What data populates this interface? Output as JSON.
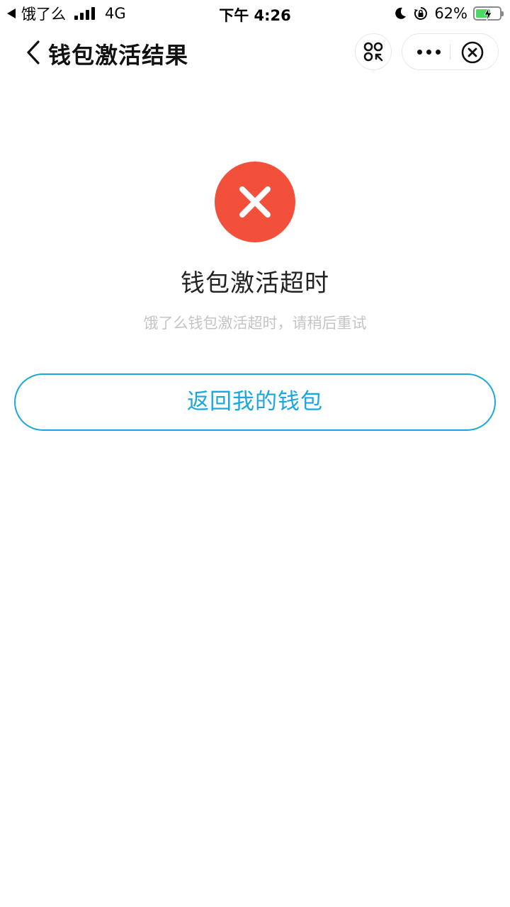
{
  "status_bar": {
    "carrier": "饿了么",
    "network": "4G",
    "time": "下午 4:26",
    "battery": "62%",
    "battery_level": 0.62,
    "icons": [
      "back-triangle-icon",
      "signal-icon",
      "moon-icon",
      "orientation-lock-icon",
      "battery-icon",
      "charging-bolt-icon"
    ]
  },
  "nav": {
    "title": "钱包激活结果",
    "icons": [
      "back-chevron-icon",
      "mini-program-switch-icon",
      "more-dots-icon",
      "close-circle-icon"
    ]
  },
  "result": {
    "title": "钱包激活超时",
    "description": "饿了么钱包激活超时，请稍后重试",
    "icon": "error-x-icon"
  },
  "actions": {
    "back_to_wallet_label": "返回我的钱包"
  },
  "colors": {
    "error_red": "#f2503b",
    "accent_blue": "#1aa7e0",
    "battery_green": "#4cd964",
    "desc_gray": "#c4c4c4"
  }
}
